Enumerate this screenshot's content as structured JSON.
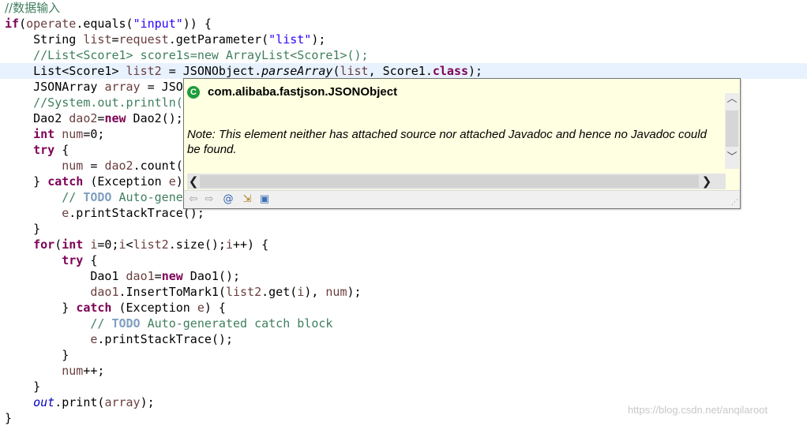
{
  "editor": {
    "l1_comment": "//数据输入",
    "l2_kw_if": "if",
    "l2_a": "(",
    "l2_var": "operate",
    "l2_b": ".equals(",
    "l2_str": "\"input\"",
    "l2_c": ")) {",
    "l3_a": "    String ",
    "l3_var1": "list",
    "l3_b": "=",
    "l3_var2": "request",
    "l3_c": ".getParameter(",
    "l3_str": "\"list\"",
    "l3_d": ");",
    "l4_comment": "    //List<Score1> score1s=new ArrayList<Score1>();",
    "l5_a": "    List<Score1> ",
    "l5_var1": "list2",
    "l5_b": " = JSONObject.",
    "l5_method": "parseArray",
    "l5_c": "(",
    "l5_var2": "list",
    "l5_d": ", Score1.",
    "l5_kw": "class",
    "l5_e": ");",
    "l6_a": "    JSONArray ",
    "l6_var": "array",
    "l6_b": " = JSO",
    "l7_comment": "    //System.out.println(",
    "l8_a": "    Dao2 ",
    "l8_var": "dao2",
    "l8_b": "=",
    "l8_kw": "new",
    "l8_c": " Dao2();",
    "l9_indent": "    ",
    "l9_kw": "int",
    "l9_sp": " ",
    "l9_var": "num",
    "l9_b": "=0;",
    "l10_indent": "    ",
    "l10_kw": "try",
    "l10_b": " {",
    "l11_indent": "        ",
    "l11_var1": "num",
    "l11_b": " = ",
    "l11_var2": "dao2",
    "l11_c": ".count(",
    "l12_a": "    } ",
    "l12_kw": "catch",
    "l12_b": " (Exception ",
    "l12_var": "e",
    "l12_c": ")",
    "l13_comment1": "        // ",
    "l13_todo": "TODO",
    "l13_comment2": " Auto-gene",
    "l14_indent": "        ",
    "l14_var": "e",
    "l14_b": ".printStackTrace();",
    "l15_text": "    }",
    "l16_indent": "    ",
    "l16_kw1": "for",
    "l16_a": "(",
    "l16_kw2": "int",
    "l16_b": " ",
    "l16_var1": "i",
    "l16_c": "=0;",
    "l16_var2": "i",
    "l16_d": "<",
    "l16_var3": "list2",
    "l16_e": ".size();",
    "l16_var4": "i",
    "l16_f": "++) {",
    "l17_indent": "        ",
    "l17_kw": "try",
    "l17_b": " {",
    "l18_a": "            Dao1 ",
    "l18_var": "dao1",
    "l18_b": "=",
    "l18_kw": "new",
    "l18_c": " Dao1();",
    "l19_indent": "            ",
    "l19_var1": "dao1",
    "l19_b": ".InsertToMark1(",
    "l19_var2": "list2",
    "l19_c": ".get(",
    "l19_var3": "i",
    "l19_d": "), ",
    "l19_var4": "num",
    "l19_e": ");",
    "l20_a": "        } ",
    "l20_kw": "catch",
    "l20_b": " (Exception ",
    "l20_var": "e",
    "l20_c": ") {",
    "l21_comment1": "            // ",
    "l21_todo": "TODO",
    "l21_comment2": " Auto-generated catch block",
    "l22_indent": "            ",
    "l22_var": "e",
    "l22_b": ".printStackTrace();",
    "l23_text": "        }",
    "l24_indent": "        ",
    "l24_var": "num",
    "l24_b": "++;",
    "l25_text": "    }",
    "l26_indent": "    ",
    "l26_fld": "out",
    "l26_b": ".print(",
    "l26_var": "array",
    "l26_c": ");",
    "l27_text": "}"
  },
  "popup": {
    "class_icon_letter": "C",
    "class_name": "com.alibaba.fastjson.JSONObject",
    "note": "Note: This element neither has attached source nor attached Javadoc and hence no Javadoc could be found.",
    "icons": {
      "scroll_up": "chevron-up-icon",
      "scroll_down": "chevron-down-icon",
      "scroll_left": "chevron-left-icon",
      "scroll_right": "chevron-right-icon",
      "back": "back-arrow-icon",
      "forward": "forward-arrow-icon",
      "at": "at-icon",
      "open_declaration": "open-declaration-icon",
      "show_in_view": "show-in-javadoc-view-icon"
    },
    "arrow_glyphs": {
      "up": "︿",
      "down": "﹀",
      "left": "❮",
      "right": "❯",
      "back": "⇦",
      "forward": "⇨",
      "at": "@",
      "open": "⇲",
      "view": "▣",
      "grip": "⋰"
    }
  },
  "watermark": "https://blog.csdn.net/anqilaroot",
  "colors": {
    "keyword": "#7f0055",
    "comment": "#3f7f5f",
    "string": "#2a00ff",
    "field": "#0000c0",
    "local_variable": "#6a3e3e",
    "todo": "#7f9fbf",
    "current_line": "#e8f2fe",
    "hover_background": "#ffffe1"
  }
}
